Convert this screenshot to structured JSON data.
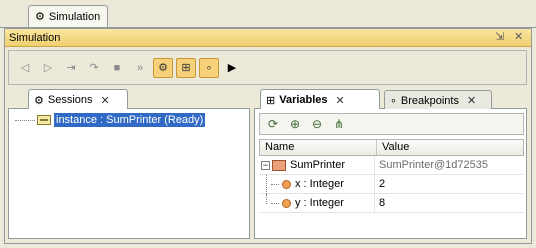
{
  "top_tab": {
    "label": "Simulation"
  },
  "view": {
    "title": "Simulation",
    "restore_glyph": "⇲",
    "close_glyph": "✕"
  },
  "toolbar": {
    "buttons": [
      {
        "name": "step-back-icon",
        "glyph": "◁",
        "active": false
      },
      {
        "name": "run-icon",
        "glyph": "▷",
        "active": false
      },
      {
        "name": "step-into-icon",
        "glyph": "⇥",
        "active": false
      },
      {
        "name": "step-over-icon",
        "glyph": "↷",
        "active": false
      },
      {
        "name": "stop-icon",
        "glyph": "■",
        "active": false
      },
      {
        "name": "skip-icon",
        "glyph": "»",
        "active": false
      },
      {
        "name": "gear-icon",
        "glyph": "⚙",
        "active": true
      },
      {
        "name": "tree-icon",
        "glyph": "⊞",
        "active": true
      },
      {
        "name": "breakpoint-icon",
        "glyph": "∘",
        "active": true
      },
      {
        "name": "expand-icon",
        "glyph": "▶",
        "active": false
      }
    ]
  },
  "sessions": {
    "tab_label": "Sessions",
    "tab_close": "✕",
    "items": [
      {
        "label": "instance : SumPrinter (Ready)"
      }
    ]
  },
  "variables": {
    "tab_label": "Variables",
    "tab_close": "✕",
    "tab2_label": "Breakpoints",
    "tab2_close": "✕",
    "columns": [
      "Name",
      "Value"
    ],
    "rows": [
      {
        "name": "SumPrinter",
        "value": "SumPrinter@1d72535",
        "level": 0
      },
      {
        "name": "x : Integer",
        "value": "2",
        "level": 1
      },
      {
        "name": "y : Integer",
        "value": "8",
        "level": 1
      }
    ],
    "toolbar_icons": [
      "refresh-icon",
      "add-watch-icon",
      "remove-watch-icon",
      "expand-all-icon"
    ]
  },
  "colors": {
    "title_bar": "#f1cf6e",
    "selection": "#316ac5",
    "active_button": "#f7d27a"
  }
}
